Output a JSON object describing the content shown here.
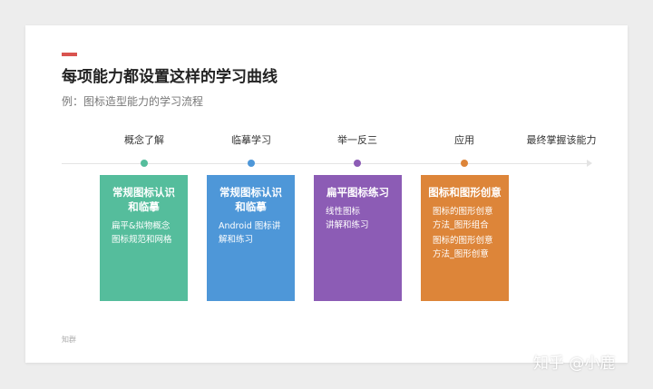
{
  "title": "每项能力都设置这样的学习曲线",
  "subtitle": "例：图标造型能力的学习流程",
  "stages": [
    {
      "label": "概念了解",
      "dot_color": "#55bd9c"
    },
    {
      "label": "临摹学习",
      "dot_color": "#4e97d8"
    },
    {
      "label": "举一反三",
      "dot_color": "#8c5cb5"
    },
    {
      "label": "应用",
      "dot_color": "#dd8539"
    },
    {
      "label": "最终掌握该能力"
    }
  ],
  "cards": [
    {
      "title_lines": [
        "常规图标认识",
        "和临摹"
      ],
      "items": [
        "扁平&拟物概念",
        "图标规范和网格"
      ],
      "color": "#55bd9c"
    },
    {
      "title_lines": [
        "常规图标认识",
        "和临摹"
      ],
      "items": [
        "Android 图标讲",
        "解和练习"
      ],
      "color": "#4e97d8"
    },
    {
      "title_lines": [
        "扁平图标练习"
      ],
      "items": [
        "线性图标",
        "讲解和练习"
      ],
      "color": "#8c5cb5"
    },
    {
      "title_lines": [
        "图标和图形创意"
      ],
      "items": [
        "图标的图形创意",
        "方法_图形组合",
        "图标的图形创意",
        "方法_图形创意"
      ],
      "color": "#dd8539"
    }
  ],
  "footer": "知群",
  "watermark": "知乎 @小鹿"
}
